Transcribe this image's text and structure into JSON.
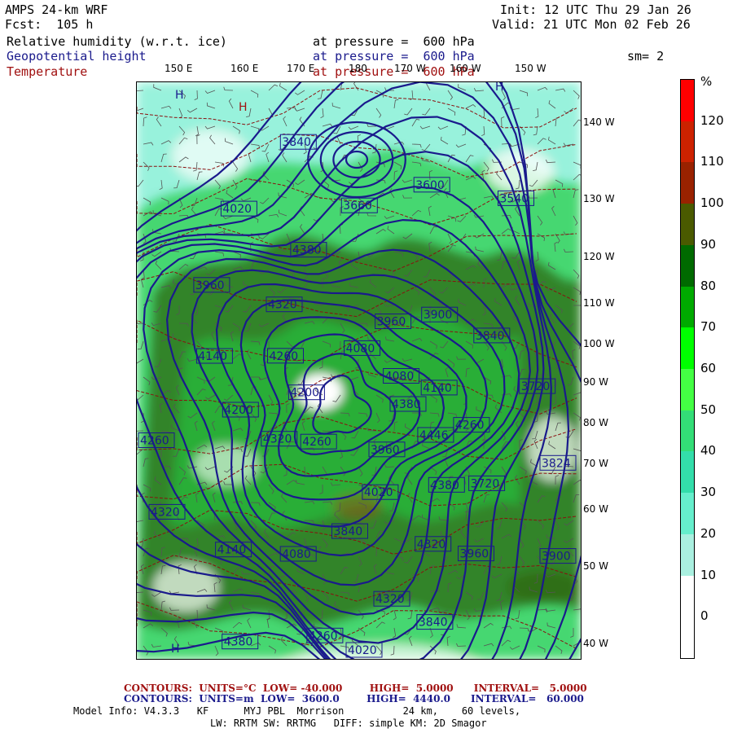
{
  "header": {
    "model": "AMPS 24-km WRF",
    "forecast": "Fcst:  105 h",
    "init": "Init: 12 UTC Thu 29 Jan 26",
    "valid": "Valid: 21 UTC Mon 02 Feb 26",
    "smoothing": "sm= 2"
  },
  "fields": [
    {
      "name": "Relative humidity (w.r.t. ice)",
      "level": "at pressure =  600 hPa",
      "color": "#000000"
    },
    {
      "name": "Geopotential height",
      "level": "at pressure =  600 hPa",
      "color": "#1a1a8c"
    },
    {
      "name": "Temperature",
      "level": "at pressure =  600 hPa",
      "color": "#a01010"
    }
  ],
  "longitude_labels": [
    "150 E",
    "160 E",
    "170 E",
    "180",
    "170 W",
    "160 W",
    "150 W"
  ],
  "latitude_labels": [
    "140 W",
    "130 W",
    "120 W",
    "110 W",
    "100 W",
    "90 W",
    "80 W",
    "70 W",
    "60 W",
    "50 W",
    "40 W"
  ],
  "height_labels": [
    "4380",
    "4446",
    "4380",
    "4320",
    "4320",
    "4260",
    "4380",
    "4260",
    "4320",
    "4200",
    "4140",
    "3960",
    "4020",
    "3840",
    "4080",
    "3960",
    "3900",
    "3840",
    "3720",
    "3824",
    "3900",
    "3960",
    "4020",
    "3840",
    "4080",
    "4140",
    "4320",
    "4260",
    "4200",
    "4260",
    "4320",
    "4380",
    "3660",
    "3600",
    "3540",
    "4080",
    "4140",
    "4260",
    "3720",
    "3960",
    "3840",
    "4020"
  ],
  "colorbar": {
    "unit": "%",
    "labels": [
      "120",
      "110",
      "100",
      "90",
      "80",
      "70",
      "60",
      "50",
      "40",
      "30",
      "20",
      "10",
      "0"
    ],
    "colors": [
      "#ff0000",
      "#cc2200",
      "#992200",
      "#4a5a00",
      "#006a00",
      "#00aa00",
      "#00ff00",
      "#44ff44",
      "#33dd77",
      "#33ddaa",
      "#66eecc",
      "#aaf0e0",
      "#ffffff",
      "#ffffff"
    ]
  },
  "footer": {
    "temp_contours": "CONTOURS:  UNITS=°C  LOW= -40.000        HIGH=  5.0000      INTERVAL=   5.0000",
    "height_contours": "CONTOURS:  UNITS=m  LOW=  3600.0        HIGH=  4440.0      INTERVAL=   60.000",
    "model_info_1": "Model Info: V4.3.3   KF      MYJ PBL  Morrison          24 km,    60 levels,",
    "model_info_2": "LW: RRTM SW: RRTMG   DIFF: simple KM: 2D Smagor"
  },
  "colors": {
    "rh_high": "#2f6a10",
    "rh_mid": "#22cc44",
    "rh_low": "#44e8c0",
    "height": "#1a1a8c",
    "temperature": "#8b1010"
  }
}
